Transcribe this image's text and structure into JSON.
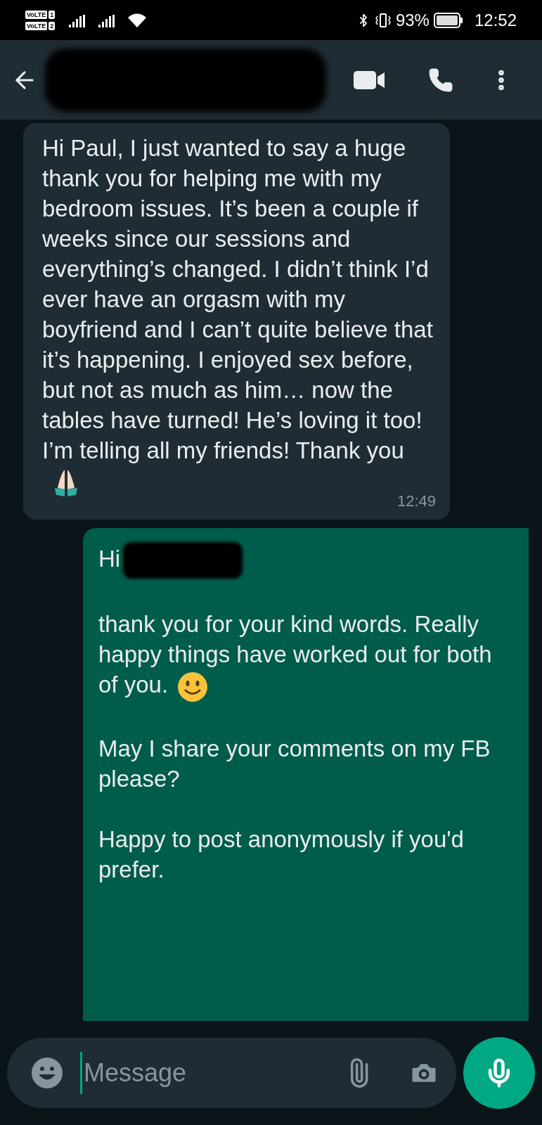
{
  "status_bar": {
    "sims": [
      {
        "label": "VoLTE",
        "number": "1"
      },
      {
        "label": "VoLTE",
        "number": "2"
      }
    ],
    "battery": "93%",
    "time": "12:52"
  },
  "messages": [
    {
      "kind": "incoming",
      "time": "12:49",
      "paragraphs": [
        [
          {
            "kind": "text",
            "text": "Hi Paul, I just wanted to say a huge thank you for helping me with my bedroom issues. It’s been a couple if weeks since our sessions and everything’s changed. I didn’t think I’d ever have an orgasm with my boyfriend and I can’t quite believe that it’s happening. I enjoyed sex before, but not as much as him… now the tables have turned! He’s loving it too! I’m telling all my friends! Thank you"
          },
          {
            "kind": "praying_hands"
          }
        ]
      ]
    },
    {
      "kind": "outgoing",
      "paragraphs": [
        [
          {
            "kind": "text",
            "text": "Hi"
          },
          {
            "kind": "redacted"
          }
        ],
        [
          {
            "kind": "text",
            "text": "thank you for your kind words. Really happy things have worked out for both of you."
          },
          {
            "kind": "smiley"
          }
        ],
        [
          {
            "kind": "text",
            "text": "May I share your comments on my FB please?"
          }
        ],
        [
          {
            "kind": "text",
            "text": "Happy to post anonymously if you'd prefer."
          }
        ]
      ]
    }
  ],
  "composer": {
    "placeholder": "Message"
  }
}
